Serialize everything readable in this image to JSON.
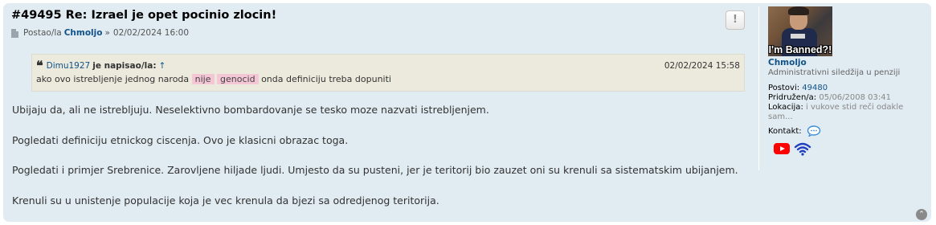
{
  "post": {
    "title": "#49495 Re: Izrael je opet pocinio zlocin!",
    "author_prefix": "Postao/la",
    "author_name": "Chmoljo",
    "author_sep": "»",
    "date": "02/02/2024 16:00",
    "report_label": "!"
  },
  "quote": {
    "icon_glyph": "❝",
    "user": "Dimu1927",
    "wrote": "je napisao/la:",
    "up_arrow": "↑",
    "date": "02/02/2024 15:58",
    "text_before": "ako ovo istrebljenje jednog naroda",
    "highlight_1": "nije",
    "highlight_2": "genocid",
    "text_after": "onda definiciju treba dopuniti"
  },
  "content": {
    "paragraphs": [
      "Ubijaju da, ali ne istrebljuju. Neselektivno bombardovanje se tesko moze nazvati istrebljenjem.",
      "Pogledati definiciju etnickog ciscenja. Ovo je klasicni obrazac toga.",
      "Pogledati i primjer Srebrenice. Zarovljene hiljade ljudi. Umjesto da su pusteni, jer je teritorij bio zauzet oni su krenuli sa sistematskim ubijanjem.",
      "Krenuli su u unistenje populacije koja je vec krenula da bjezi sa odredjenog teritorija."
    ]
  },
  "profile": {
    "avatar_caption": "I'm Banned?!",
    "name": "Chmoljo",
    "rank": "Administrativni siledžija u penziji",
    "posts_label": "Postovi:",
    "posts_value": "49480",
    "joined_label": "Pridružen/a:",
    "joined_value": "05/06/2008 03:41",
    "location_label": "Lokacija:",
    "location_value": "i vukove stid reči odakle sam...",
    "contact_label": "Kontakt:",
    "icons": [
      "chat-bubble-icon",
      "youtube-icon",
      "wifi-icon"
    ]
  },
  "colors": {
    "post_bg": "#e1ebf2",
    "link": "#105289",
    "quote_bg": "#ebeadd",
    "highlight": "#f4c6d6",
    "youtube_red": "#ff0000",
    "wifi_blue": "#1f3fbf"
  },
  "back_to_top": "⌃"
}
